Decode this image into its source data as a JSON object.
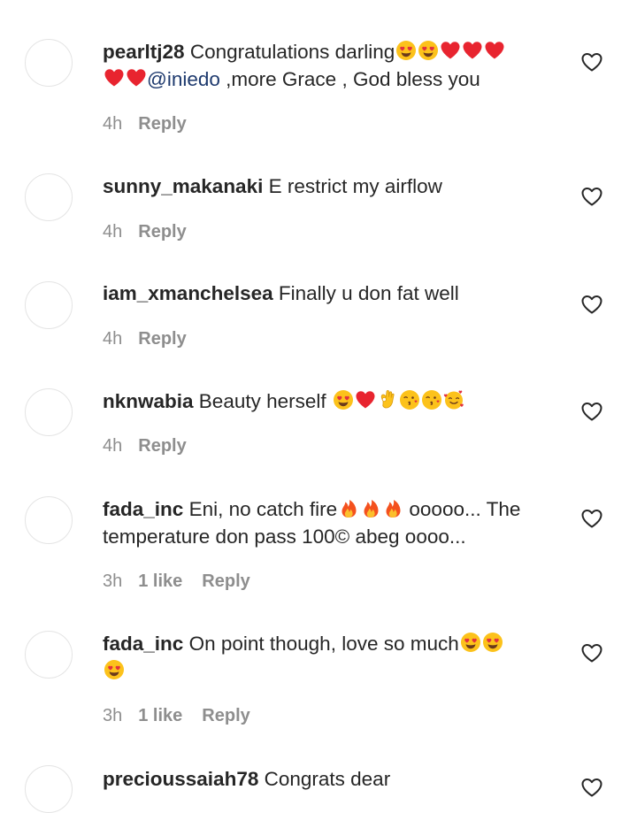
{
  "comments": [
    {
      "username": "pearltj28",
      "text_before": "Congratulations darling",
      "emojis_1": [
        "heart-eyes",
        "heart-eyes",
        "red-heart",
        "red-heart",
        "red-heart",
        "red-heart",
        "red-heart"
      ],
      "mention": "@iniedo",
      "text_after": " ,more Grace , God bless you",
      "time": "4h",
      "reply": "Reply"
    },
    {
      "username": "sunny_makanaki",
      "text": "E restrict my airflow",
      "time": "4h",
      "reply": "Reply"
    },
    {
      "username": "iam_xmanchelsea",
      "text": "Finally u don fat well",
      "time": "4h",
      "reply": "Reply"
    },
    {
      "username": "nknwabia",
      "text": "Beauty herself ",
      "emojis": [
        "heart-eyes",
        "red-heart",
        "ok-hand",
        "kissing-face",
        "kissing-face",
        "smiling-hearts"
      ],
      "time": "4h",
      "reply": "Reply"
    },
    {
      "username": "fada_inc",
      "text_before": "Eni, no catch fire",
      "emojis": [
        "fire",
        "fire",
        "fire"
      ],
      "text_after": " ooooo... The temperature don pass 100© abeg oooo...",
      "time": "3h",
      "likes": "1 like",
      "reply": "Reply"
    },
    {
      "username": "fada_inc",
      "text": "On point though, love so much",
      "emojis": [
        "heart-eyes",
        "heart-eyes",
        "heart-eyes"
      ],
      "time": "3h",
      "likes": "1 like",
      "reply": "Reply"
    },
    {
      "username": "precioussaiah78",
      "text": "Congrats dear"
    }
  ],
  "colors": {
    "text": "#262626",
    "meta": "#8e8e8e",
    "mention": "#1e3a6e",
    "heart_red": "#e8242f",
    "avatar_border": "#e4e4e4"
  }
}
